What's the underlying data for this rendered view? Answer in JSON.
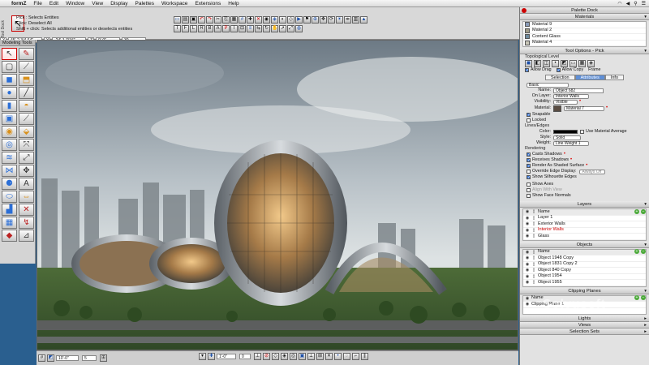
{
  "menubar": {
    "app": "formZ",
    "items": [
      "File",
      "Edit",
      "Window",
      "View",
      "Display",
      "Palettes",
      "Workspace",
      "Extensions",
      "Help"
    ]
  },
  "pick": {
    "title": "Pick : Selects Entities",
    "line2": "Click: Deselect All",
    "line3": "Shift + click: Selects additional entities or deselects entities"
  },
  "coords": {
    "a": "45'-2 3/4 64\"",
    "b": "-24'-1 7/16\"",
    "c": "0'-0\"",
    "d": "30"
  },
  "left_panel": {
    "title": "Modeling Tools",
    "dock_label": "Tool Dock"
  },
  "bottom_bar": {
    "field1": "10'-0\"",
    "field2": "5",
    "field3": "1'-0\"",
    "field4": "0"
  },
  "dock": {
    "title": "Palette Dock",
    "materials": {
      "title": "Materials",
      "items": [
        {
          "label": "Material 9",
          "color": "#8a9bb8"
        },
        {
          "label": "Material 2",
          "color": "#a09b88"
        },
        {
          "label": "Content Glass",
          "color": "#6e8a9e"
        },
        {
          "label": "Material 4",
          "color": "#c8c6b8"
        }
      ]
    },
    "tool_options": {
      "title": "Tool Options - Pick",
      "topological_level": "Topological Level",
      "allow_drag": "Allow Drag",
      "allow_copy": "Allow Copy",
      "frame": "Frame",
      "tabs": [
        "Selection",
        "Attributes",
        "Info"
      ],
      "active_tab": "Attributes",
      "basic": "Basic",
      "name_label": "Name:",
      "name_value": "Object 682",
      "on_layer_label": "On Layer:",
      "on_layer_value": "Interior Walls",
      "visibility_label": "Visibility:",
      "visibility_value": "Visible",
      "material_label": "Material:",
      "material_value": "Material 7",
      "snapable": "Snapable",
      "locked": "Locked",
      "lines_edges": "Lines/Edges",
      "color_label": "Color:",
      "use_material_average": "Use Material Average",
      "style_label": "Style:",
      "style_value": "Solid",
      "weight_label": "Weight:",
      "weight_value": "Line Weight 1",
      "rendering": "Rendering",
      "casts_shadows": "Casts Shadows",
      "receives_shadows": "Receives Shadows",
      "render_as_shaded": "Render As Shaded Surface",
      "override_edge": "Override Edge Display:",
      "override_value": "Always Off",
      "show_silhouette": "Show Silhouette Edges",
      "show_axes": "Show Axes",
      "align_with_view": "Align With View",
      "show_face_normals": "Show Face Normals"
    },
    "layers": {
      "title": "Layers",
      "header": "Name",
      "items": [
        "Layer 1",
        "Exterior Walls",
        "Interior Walls",
        "Glass"
      ],
      "selected": 2
    },
    "objects": {
      "title": "Objects",
      "header": "Name",
      "items": [
        "Object 1948 Copy",
        "Object 1831 Copy 2",
        "Object 840 Copy",
        "Object 1954",
        "Object 1955"
      ]
    },
    "clipping_planes": {
      "title": "Clipping Planes",
      "header": "Name",
      "items": [
        "Clipping Plane 1"
      ]
    },
    "lights": {
      "title": "Lights"
    },
    "views": {
      "title": "Views"
    },
    "selection_sets": {
      "title": "Selection Sets"
    }
  },
  "watermark": "Solvusoft"
}
